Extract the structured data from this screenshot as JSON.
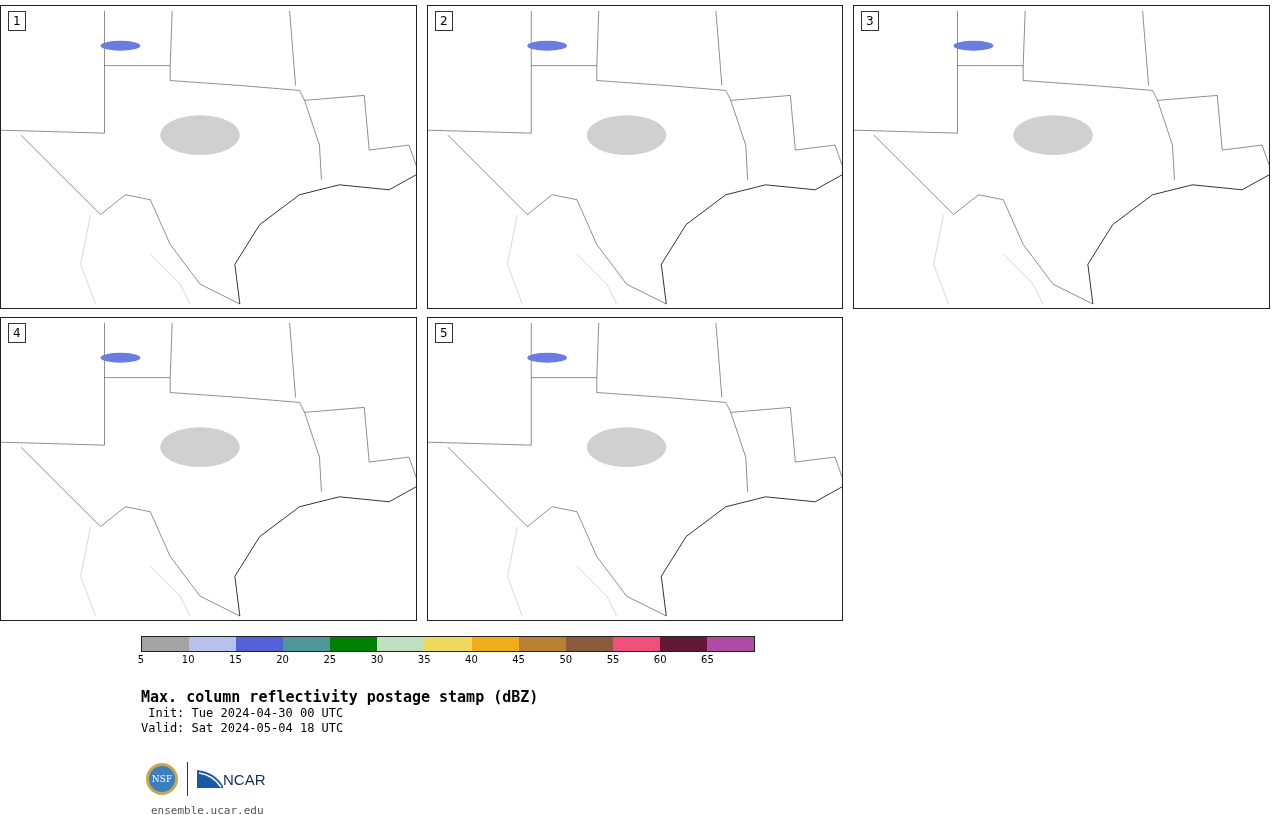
{
  "panels": [
    {
      "label": "1"
    },
    {
      "label": "2"
    },
    {
      "label": "3"
    },
    {
      "label": "4"
    },
    {
      "label": "5"
    }
  ],
  "colorbar": {
    "segments": [
      {
        "color": "#a3a3a3"
      },
      {
        "color": "#b6c1ec"
      },
      {
        "color": "#5362d6"
      },
      {
        "color": "#50979a"
      },
      {
        "color": "#008000"
      },
      {
        "color": "#bfdfbf"
      },
      {
        "color": "#eed95e"
      },
      {
        "color": "#f0ad1a"
      },
      {
        "color": "#b98233"
      },
      {
        "color": "#8c5a3f"
      },
      {
        "color": "#f2507c"
      },
      {
        "color": "#631838"
      },
      {
        "color": "#ad4ba5"
      }
    ],
    "ticks": [
      "5",
      "10",
      "15",
      "20",
      "25",
      "30",
      "35",
      "40",
      "45",
      "50",
      "55",
      "60",
      "65"
    ]
  },
  "title": "Max. column reflectivity postage stamp (dBZ)",
  "init": " Init: Tue 2024-04-30 00 UTC",
  "valid": "Valid: Sat 2024-05-04 18 UTC",
  "logos": {
    "nsf": "NSF",
    "ncar": "NCAR"
  },
  "url": "ensemble.ucar.edu"
}
